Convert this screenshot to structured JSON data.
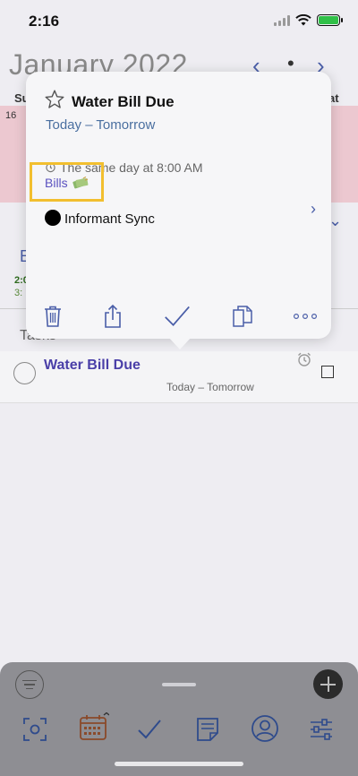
{
  "status_bar": {
    "time": "2:16"
  },
  "calendar": {
    "month_title": "January 2022",
    "prev_icon": "chevron-left-icon",
    "today_icon": "dot-icon",
    "next_icon": "chevron-right-icon",
    "weekday_first": "Su",
    "weekday_last": "at",
    "visible_day": "16",
    "events_letter": "E",
    "event_time_1": "2:0",
    "event_time_2": "3:"
  },
  "tasks": {
    "header": "Tasks",
    "items": [
      {
        "title": "Water Bill Due",
        "dates": "Today – Tomorrow"
      }
    ]
  },
  "popover": {
    "title": "Water Bill Due",
    "dates": "Today – Tomorrow",
    "alarm_text": "The same day at 8:00 AM",
    "tag": "Bills",
    "calendar_name": "Informant Sync",
    "calendar_color": "#000000",
    "toolbar": [
      "trash-icon",
      "share-icon",
      "checkmark-icon",
      "duplicate-icon",
      "more-icon"
    ]
  },
  "bottom_bar": {
    "tabs": [
      "scan-icon",
      "calendar-icon",
      "tasks-icon",
      "notes-icon",
      "contacts-icon",
      "settings-icon"
    ]
  },
  "colors": {
    "accent": "#4a5ea8",
    "task_title": "#4a3fa8",
    "highlight": "#f2bf2f",
    "week_row": "#ecc8d0"
  }
}
